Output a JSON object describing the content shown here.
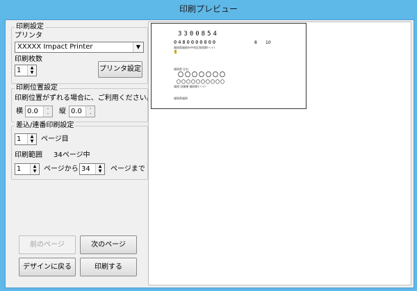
{
  "window": {
    "title": "印刷プレビュー"
  },
  "print_settings": {
    "legend": "印刷設定",
    "printer_label": "プリンタ",
    "printer_value": "XXXXX Impact Printer",
    "copies_label": "印刷枚数",
    "copies_value": "1",
    "printer_setup_button": "プリンタ設定"
  },
  "position_settings": {
    "legend": "印刷位置設定",
    "note": "印刷位置がずれる場合に、ご利用ください。",
    "horizontal_label": "横",
    "horizontal_value": "0.0",
    "vertical_label": "縦",
    "vertical_value": "0.0"
  },
  "serial_settings": {
    "legend": "差込/連番印刷設定",
    "page_value": "1",
    "page_suffix": "ページ目",
    "range_label": "印刷範囲",
    "total_pages": "34ページ中",
    "from_value": "1",
    "from_suffix": "ページから",
    "to_value": "34",
    "to_suffix": "ページまで"
  },
  "buttons": {
    "prev_page": "前のページ",
    "next_page": "次のページ",
    "back_to_design": "デザインに戻る",
    "print": "印刷する"
  },
  "preview": {
    "line1": "3300854",
    "line2": "0480000000",
    "line2_num_a": "8",
    "line2_num_b": "10",
    "small1": "福岡県福岡市中央区和知野(ヘイ)",
    "small2": "福岡県 左右",
    "circles1": "〇〇〇〇〇〇〇",
    "circles2": "〇〇〇〇〇〇〇〇〇〇",
    "small3": "福岡 田端様 福岡県(ヘイ)",
    "small4": "福岡県福岡"
  }
}
